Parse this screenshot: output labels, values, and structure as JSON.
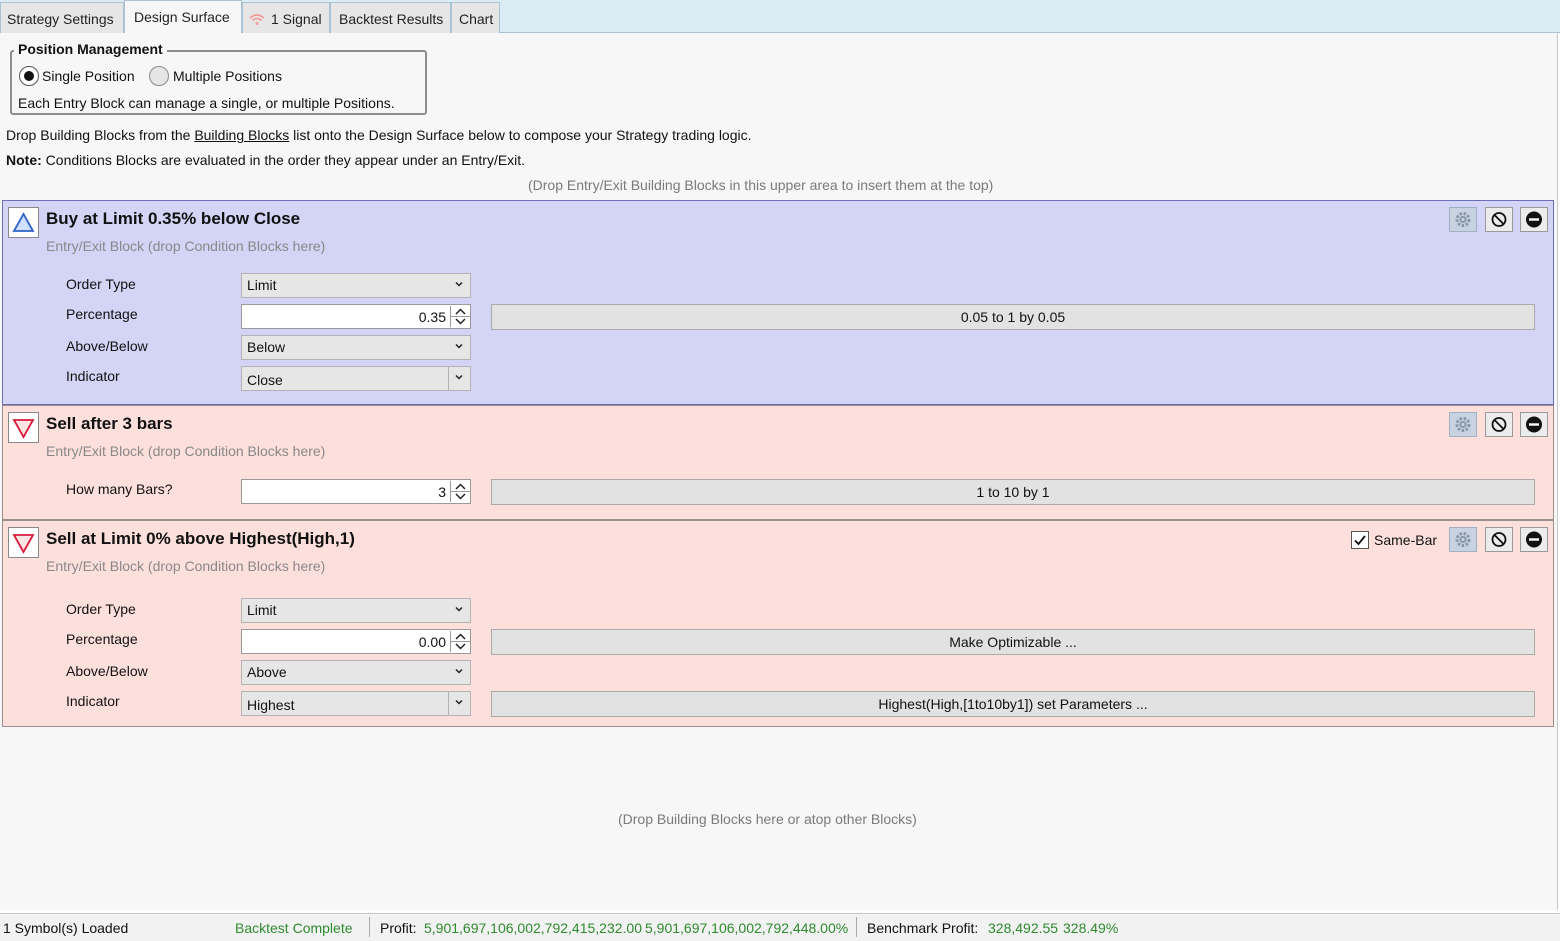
{
  "tabs": [
    {
      "label": "Strategy Settings"
    },
    {
      "label": "Design Surface"
    },
    {
      "label": "1 Signal"
    },
    {
      "label": "Backtest Results"
    },
    {
      "label": "Chart"
    }
  ],
  "position_management": {
    "title": "Position Management",
    "single_label": "Single Position",
    "multiple_label": "Multiple Positions",
    "selected": "Single Position",
    "description": "Each Entry Block can manage a single, or multiple Positions."
  },
  "instructions": {
    "line1_prefix": "Drop Building Blocks from the ",
    "line1_link": "Building Blocks",
    "line1_suffix": " list onto the Design Surface below to compose your Strategy trading logic.",
    "note_label": "Note:",
    "note_text": " Conditions Blocks are evaluated in the order they appear under an Entry/Exit.",
    "upper_drop_hint": "(Drop Entry/Exit Building Blocks in this upper area to insert them at the top)",
    "lower_drop_hint": "(Drop Building Blocks here or atop other Blocks)"
  },
  "blocks": [
    {
      "title": "Buy at Limit 0.35% below Close",
      "subtitle": "Entry/Exit Block (drop Condition Blocks here)",
      "order_type_label": "Order Type",
      "order_type_value": "Limit",
      "percentage_label": "Percentage",
      "percentage_value": "0.35",
      "percentage_range": "0.05 to 1 by 0.05",
      "above_below_label": "Above/Below",
      "above_below_value": "Below",
      "indicator_label": "Indicator",
      "indicator_value": "Close"
    },
    {
      "title": "Sell after 3 bars",
      "subtitle": "Entry/Exit Block (drop Condition Blocks here)",
      "bars_label": "How many Bars?",
      "bars_value": "3",
      "bars_range": "1 to 10 by 1"
    },
    {
      "title": "Sell at Limit 0% above Highest(High,1)",
      "subtitle": "Entry/Exit Block (drop Condition Blocks here)",
      "same_bar_label": "Same-Bar",
      "same_bar_checked": true,
      "order_type_label": "Order Type",
      "order_type_value": "Limit",
      "percentage_label": "Percentage",
      "percentage_value": "0.00",
      "percentage_button": "Make Optimizable ...",
      "above_below_label": "Above/Below",
      "above_below_value": "Above",
      "indicator_label": "Indicator",
      "indicator_value": "Highest",
      "indicator_button": "Highest(High,[1to10by1]) set Parameters ..."
    }
  ],
  "icons": [
    "buy-triangle-icon",
    "sell-triangle-icon",
    "gear-icon",
    "disable-icon",
    "remove-icon",
    "wifi-signal-icon",
    "chevron-down-icon",
    "spin-up-icon",
    "spin-down-icon",
    "checkmark-icon"
  ],
  "status": {
    "symbols": "1 Symbol(s) Loaded",
    "backtest": "Backtest Complete",
    "profit_label": "Profit:",
    "profit_value": "5,901,697,106,002,792,415,232.00",
    "profit_pct": "5,901,697,106,002,792,448.00%",
    "benchmark_label": "Benchmark Profit:",
    "benchmark_value": "328,492.55",
    "benchmark_pct": "328.49%"
  },
  "colors": {
    "buy_block": "#d4d4f6",
    "sell_block": "#fde0dc",
    "status_green": "#2e8b2e",
    "tab_bar": "#dcecf5"
  }
}
